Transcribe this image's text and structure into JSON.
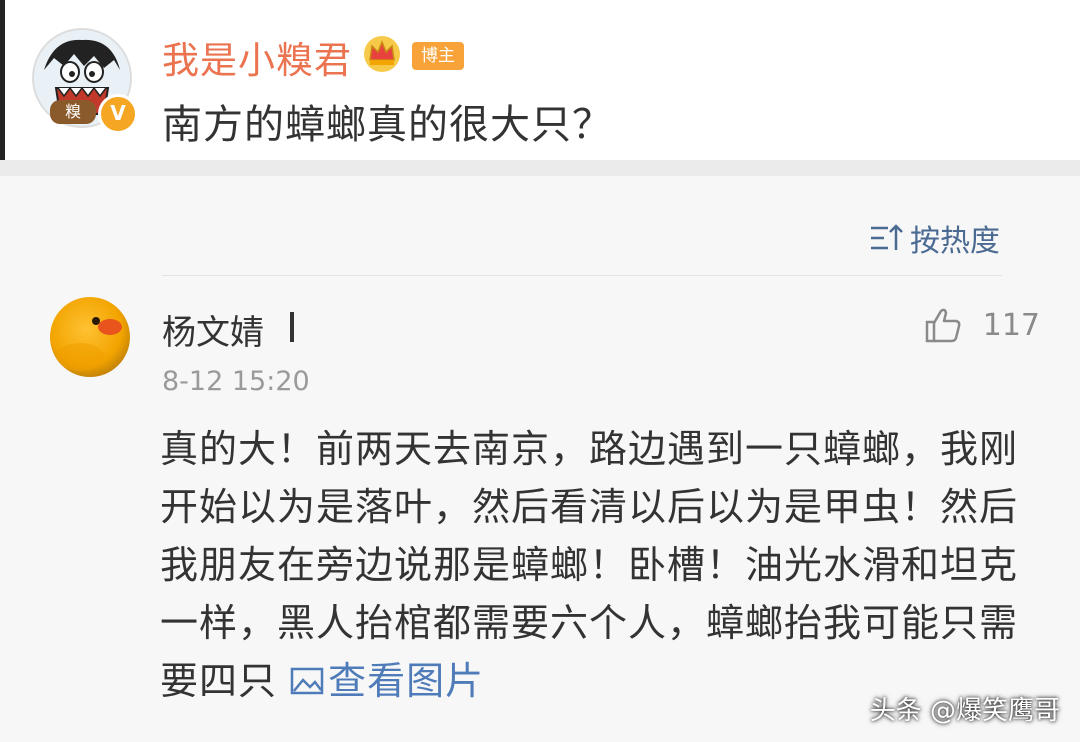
{
  "post": {
    "author_name": "我是小糗君",
    "author_tag": "糗",
    "badge_label": "博主",
    "verified_mark": "V",
    "text": "南方的蟑螂真的很大只？"
  },
  "sort": {
    "label": "按热度"
  },
  "comment": {
    "author_name": "杨文婧",
    "like_count": "117",
    "timestamp": "8-12 15:20",
    "text": "真的大！前两天去南京，路边遇到一只蟑螂，我刚开始以为是落叶，然后看清以后以为是甲虫！然后我朋友在旁边说那是蟑螂！卧槽！油光水滑和坦克一样，黑人抬棺都需要六个人，蟑螂抬我可能只需要四只",
    "view_image_label": "查看图片"
  },
  "watermark": "头条 @爆笑鹰哥",
  "icons": {
    "crown": "crown-icon",
    "sort": "sort-icon",
    "like": "thumbs-up-icon",
    "picture": "picture-icon"
  },
  "colors": {
    "author_name": "#eb7350",
    "badge": "#f7a33a",
    "link": "#4f7cb8",
    "sort": "#4a6a92"
  }
}
